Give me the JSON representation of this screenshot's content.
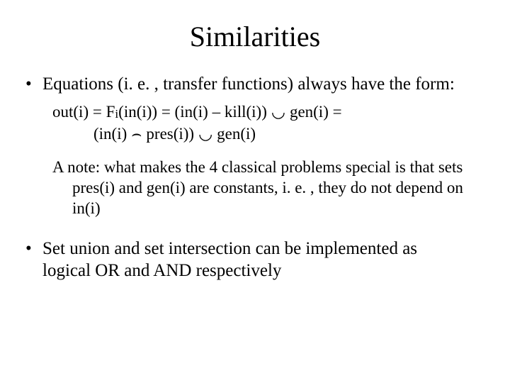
{
  "title": "Similarities",
  "bullet1": "Equations (i. e. , transfer functions) always have the form:",
  "eq": {
    "l1_a": "out(i) = F",
    "l1_sub": "i",
    "l1_b": "(in(i)) = (in(i) – kill(i)) ",
    "l1_c": " gen(i) =",
    "l2_a": "(in(i) ",
    "l2_b": " pres(i)) ",
    "l2_c": " gen(i)"
  },
  "note_line1": "A note: what makes the 4 classical problems special is that sets",
  "note_line2": "pres(i) and gen(i) are constants, i. e. , they do not depend on in(i)",
  "bullet2_line1": "Set union and set intersection can be implemented as",
  "bullet2_line2": "logical OR and AND respectively",
  "sym": {
    "cup": "◡",
    "cap": "⌢"
  }
}
